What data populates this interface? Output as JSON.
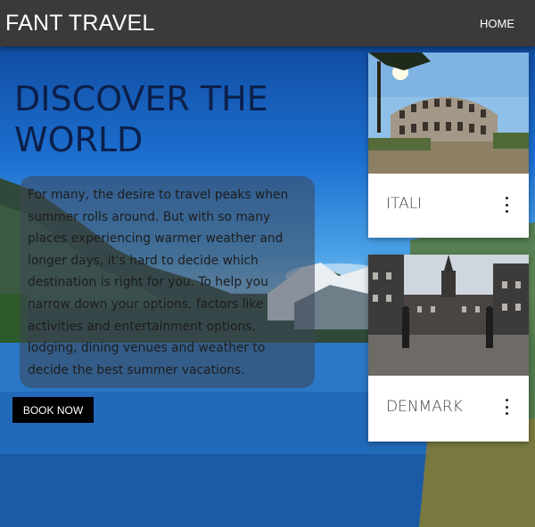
{
  "brand": "FANT TRAVEL",
  "nav": {
    "home": "HOME"
  },
  "hero": {
    "title": "DISCOVER THE WORLD",
    "intro": "For many, the desire to travel peaks when summer rolls around. But with so many places experiencing warmer weather and longer days, it's hard to decide which destination is right for you. To help you narrow down your options, factors like activities and entertainment options, lodging, dining venues and weather to decide the best summer vacations.",
    "button": "BOOK NOW"
  },
  "cards": [
    {
      "label": "ITALI",
      "image": "colosseum-photo",
      "menu_icon": "more-vert-icon"
    },
    {
      "label": "DENMARK",
      "image": "copenhagen-square-photo",
      "menu_icon": "more-vert-icon"
    }
  ],
  "colors": {
    "navbar": "#3a3a3a",
    "button": "#000000",
    "title": "#0c1f4a",
    "card": "#ffffff"
  }
}
